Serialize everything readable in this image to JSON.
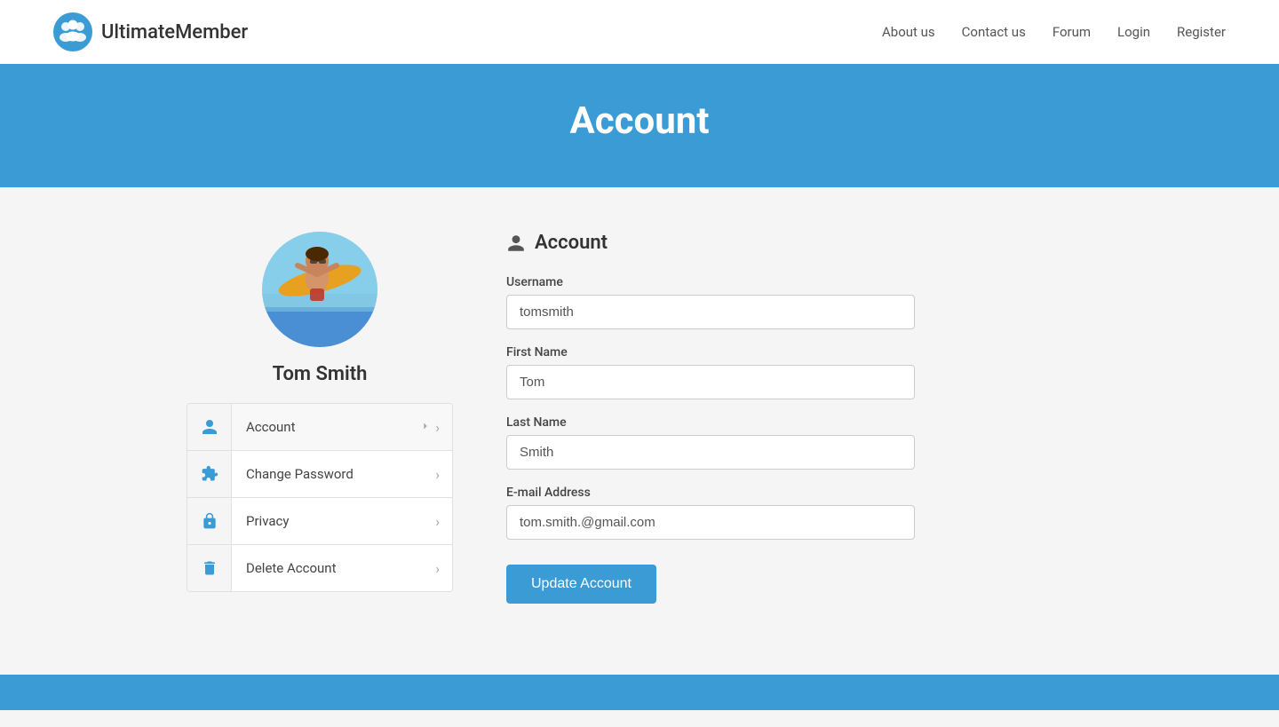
{
  "brand": {
    "name": "UltimateMember"
  },
  "nav": {
    "links": [
      {
        "label": "About us",
        "href": "#"
      },
      {
        "label": "Contact us",
        "href": "#"
      },
      {
        "label": "Forum",
        "href": "#"
      },
      {
        "label": "Login",
        "href": "#"
      },
      {
        "label": "Register",
        "href": "#"
      }
    ]
  },
  "pageHeader": {
    "title": "Account"
  },
  "sidebar": {
    "userName": "Tom Smith",
    "menu": [
      {
        "label": "Account",
        "icon": "user",
        "active": true
      },
      {
        "label": "Change Password",
        "icon": "puzzle",
        "active": false
      },
      {
        "label": "Privacy",
        "icon": "lock",
        "active": false
      },
      {
        "label": "Delete Account",
        "icon": "trash",
        "active": false
      }
    ]
  },
  "form": {
    "title": "Account",
    "fields": {
      "username": {
        "label": "Username",
        "value": "tomsmith",
        "placeholder": "tomsmith"
      },
      "firstName": {
        "label": "First Name",
        "value": "Tom",
        "placeholder": "Tom"
      },
      "lastName": {
        "label": "Last Name",
        "value": "Smith",
        "placeholder": "Smith"
      },
      "email": {
        "label": "E-mail Address",
        "value": "tom.smith.@gmail.com",
        "placeholder": "tom.smith.@gmail.com"
      }
    },
    "submitLabel": "Update Account"
  },
  "colors": {
    "primary": "#3a9bd5",
    "accent": "#3a9bd5"
  }
}
